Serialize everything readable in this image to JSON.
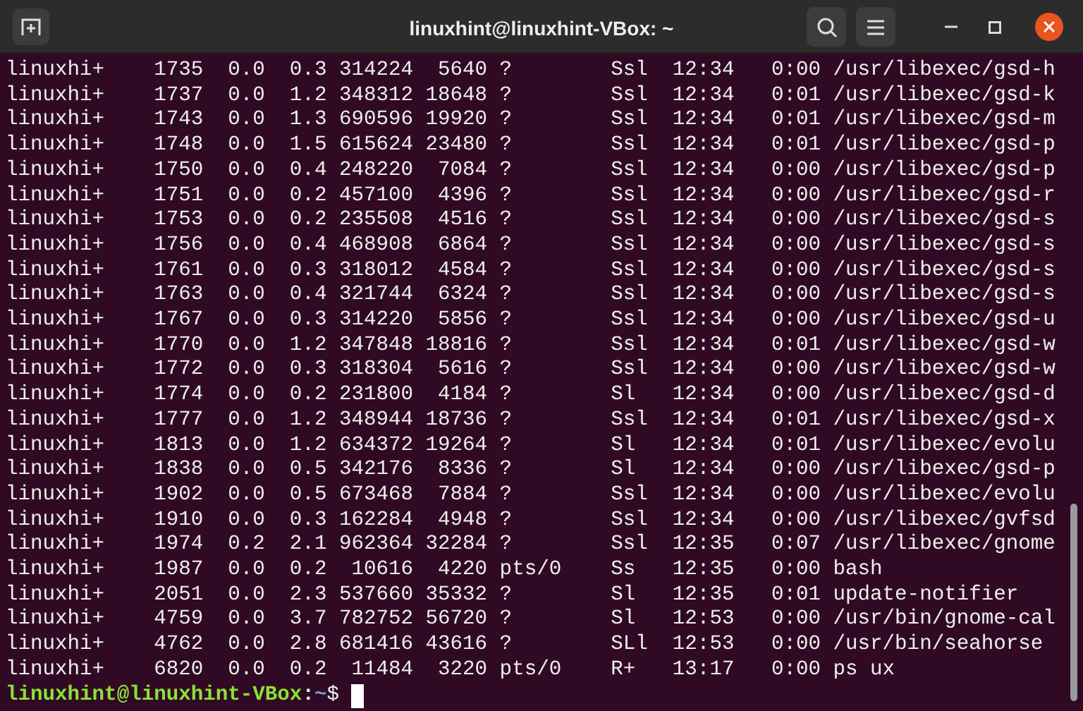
{
  "window": {
    "title": "linuxhint@linuxhint-VBox: ~"
  },
  "terminal": {
    "lines": [
      "linuxhi+    1735  0.0  0.3 314224  5640 ?        Ssl  12:34   0:00 /usr/libexec/gsd-h",
      "linuxhi+    1737  0.0  1.2 348312 18648 ?        Ssl  12:34   0:01 /usr/libexec/gsd-k",
      "linuxhi+    1743  0.0  1.3 690596 19920 ?        Ssl  12:34   0:01 /usr/libexec/gsd-m",
      "linuxhi+    1748  0.0  1.5 615624 23480 ?        Ssl  12:34   0:01 /usr/libexec/gsd-p",
      "linuxhi+    1750  0.0  0.4 248220  7084 ?        Ssl  12:34   0:00 /usr/libexec/gsd-p",
      "linuxhi+    1751  0.0  0.2 457100  4396 ?        Ssl  12:34   0:00 /usr/libexec/gsd-r",
      "linuxhi+    1753  0.0  0.2 235508  4516 ?        Ssl  12:34   0:00 /usr/libexec/gsd-s",
      "linuxhi+    1756  0.0  0.4 468908  6864 ?        Ssl  12:34   0:00 /usr/libexec/gsd-s",
      "linuxhi+    1761  0.0  0.3 318012  4584 ?        Ssl  12:34   0:00 /usr/libexec/gsd-s",
      "linuxhi+    1763  0.0  0.4 321744  6324 ?        Ssl  12:34   0:00 /usr/libexec/gsd-s",
      "linuxhi+    1767  0.0  0.3 314220  5856 ?        Ssl  12:34   0:00 /usr/libexec/gsd-u",
      "linuxhi+    1770  0.0  1.2 347848 18816 ?        Ssl  12:34   0:01 /usr/libexec/gsd-w",
      "linuxhi+    1772  0.0  0.3 318304  5616 ?        Ssl  12:34   0:00 /usr/libexec/gsd-w",
      "linuxhi+    1774  0.0  0.2 231800  4184 ?        Sl   12:34   0:00 /usr/libexec/gsd-d",
      "linuxhi+    1777  0.0  1.2 348944 18736 ?        Ssl  12:34   0:01 /usr/libexec/gsd-x",
      "linuxhi+    1813  0.0  1.2 634372 19264 ?        Sl   12:34   0:01 /usr/libexec/evolu",
      "linuxhi+    1838  0.0  0.5 342176  8336 ?        Sl   12:34   0:00 /usr/libexec/gsd-p",
      "linuxhi+    1902  0.0  0.5 673468  7884 ?        Ssl  12:34   0:00 /usr/libexec/evolu",
      "linuxhi+    1910  0.0  0.3 162284  4948 ?        Ssl  12:34   0:00 /usr/libexec/gvfsd",
      "linuxhi+    1974  0.2  2.1 962364 32284 ?        Ssl  12:35   0:07 /usr/libexec/gnome",
      "linuxhi+    1987  0.0  0.2  10616  4220 pts/0    Ss   12:35   0:00 bash",
      "linuxhi+    2051  0.0  2.3 537660 35332 ?        Sl   12:35   0:01 update-notifier",
      "linuxhi+    4759  0.0  3.7 782752 56720 ?        Sl   12:53   0:00 /usr/bin/gnome-cal",
      "linuxhi+    4762  0.0  2.8 681416 43616 ?        SLl  12:53   0:00 /usr/bin/seahorse",
      "linuxhi+    6820  0.0  0.2  11484  3220 pts/0    R+   13:17   0:00 ps ux"
    ],
    "prompt": {
      "user_host": "linuxhint@linuxhint-VBox",
      "separator": ":",
      "path": "~",
      "symbol": "$ "
    }
  }
}
